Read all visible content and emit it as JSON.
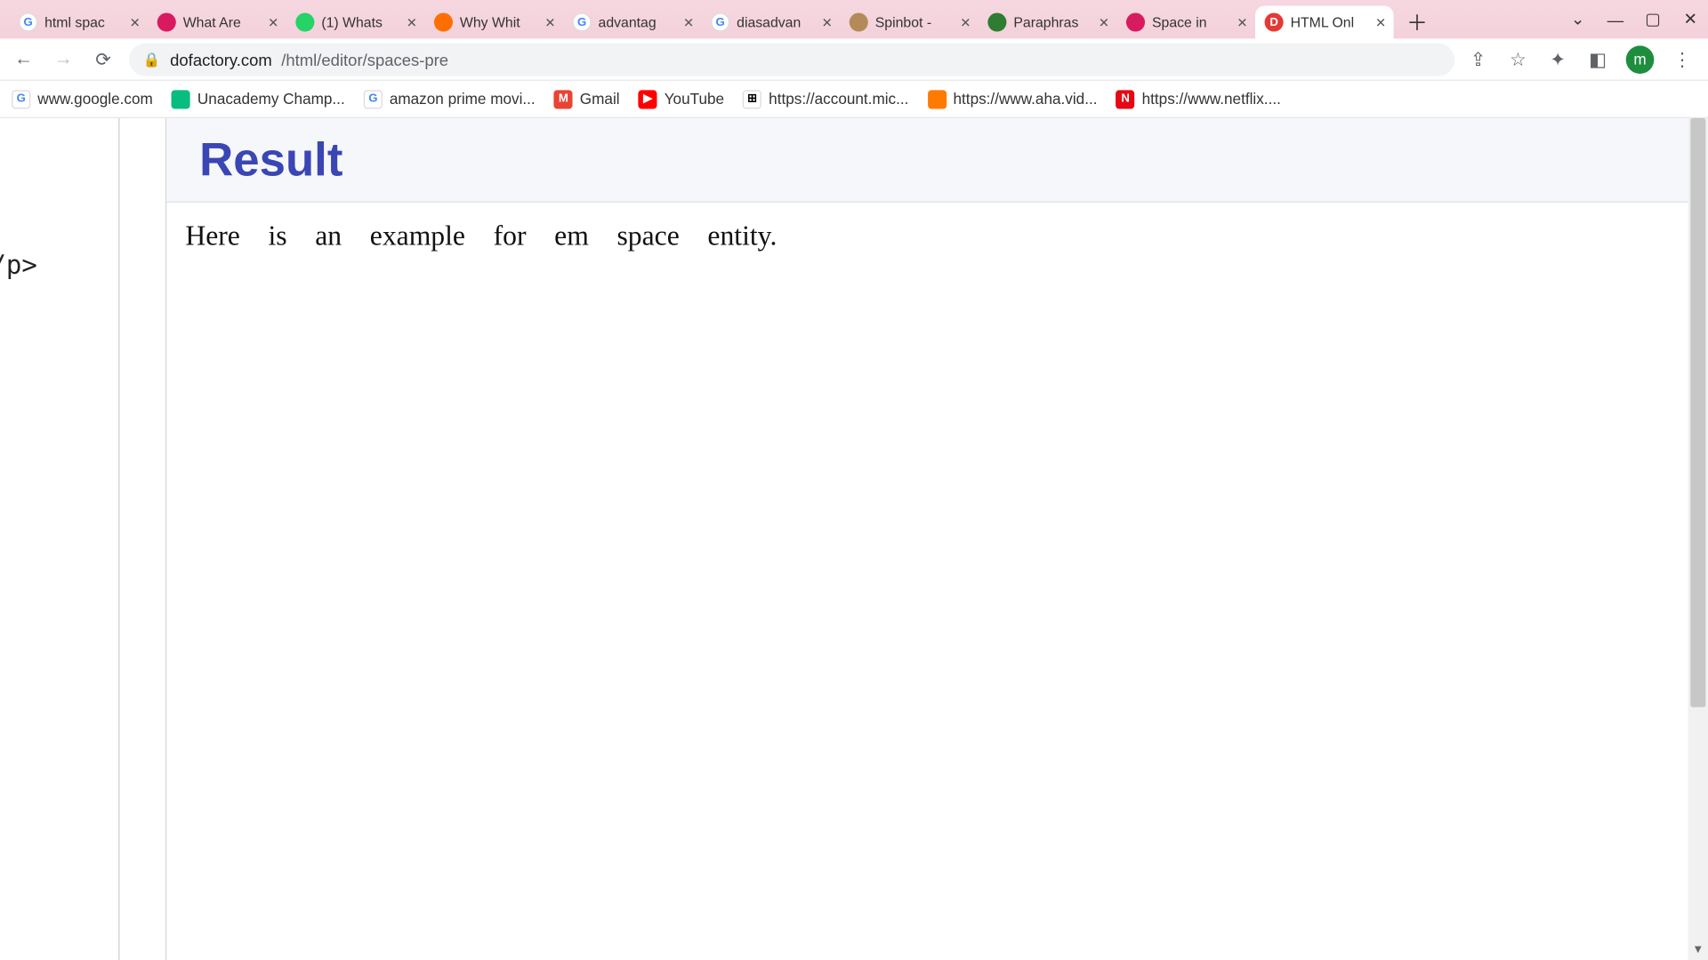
{
  "window": {
    "tabs": [
      {
        "title": "html spac",
        "favicon_letter": "G",
        "favicon_bg": "#ffffff",
        "favicon_fg": "#4285f4"
      },
      {
        "title": "What Are",
        "favicon_letter": "",
        "favicon_bg": "#d81b60"
      },
      {
        "title": "(1) Whats",
        "favicon_letter": "",
        "favicon_bg": "#25d366"
      },
      {
        "title": "Why Whit",
        "favicon_letter": "",
        "favicon_bg": "#ff6f00"
      },
      {
        "title": "advantag",
        "favicon_letter": "G",
        "favicon_bg": "#ffffff",
        "favicon_fg": "#4285f4"
      },
      {
        "title": "diasadvan",
        "favicon_letter": "G",
        "favicon_bg": "#ffffff",
        "favicon_fg": "#4285f4"
      },
      {
        "title": "Spinbot -",
        "favicon_letter": "",
        "favicon_bg": "#b38b59"
      },
      {
        "title": "Paraphras",
        "favicon_letter": "",
        "favicon_bg": "#2e7d32"
      },
      {
        "title": "Space in",
        "favicon_letter": "",
        "favicon_bg": "#d81b60"
      },
      {
        "title": "HTML Onl",
        "favicon_letter": "D",
        "favicon_bg": "#e53935",
        "active": true
      }
    ],
    "url_host": "dofactory.com",
    "url_path": "/html/editor/spaces-pre",
    "avatar_letter": "m"
  },
  "bookmarks": [
    {
      "label": "www.google.com",
      "favicon_bg": "#ffffff",
      "favicon_fg": "#4285f4",
      "letter": "G"
    },
    {
      "label": "Unacademy Champ...",
      "favicon_bg": "#08bd80",
      "letter": ""
    },
    {
      "label": "amazon prime movi...",
      "favicon_bg": "#ffffff",
      "favicon_fg": "#4285f4",
      "letter": "G"
    },
    {
      "label": "Gmail",
      "favicon_bg": "#ea4335",
      "letter": "M"
    },
    {
      "label": "YouTube",
      "favicon_bg": "#ff0000",
      "letter": "▶"
    },
    {
      "label": "https://account.mic...",
      "favicon_bg": "#ffffff",
      "letter": "⊞",
      "favicon_fg": "#000"
    },
    {
      "label": "https://www.aha.vid...",
      "favicon_bg": "#ff7a00",
      "letter": ""
    },
    {
      "label": "https://www.netflix....",
      "favicon_bg": "#e50914",
      "letter": "N"
    }
  ],
  "editor": {
    "code_fragment": "/p>"
  },
  "result": {
    "heading": "Result",
    "sentence": "Here is an example for em space entity."
  }
}
